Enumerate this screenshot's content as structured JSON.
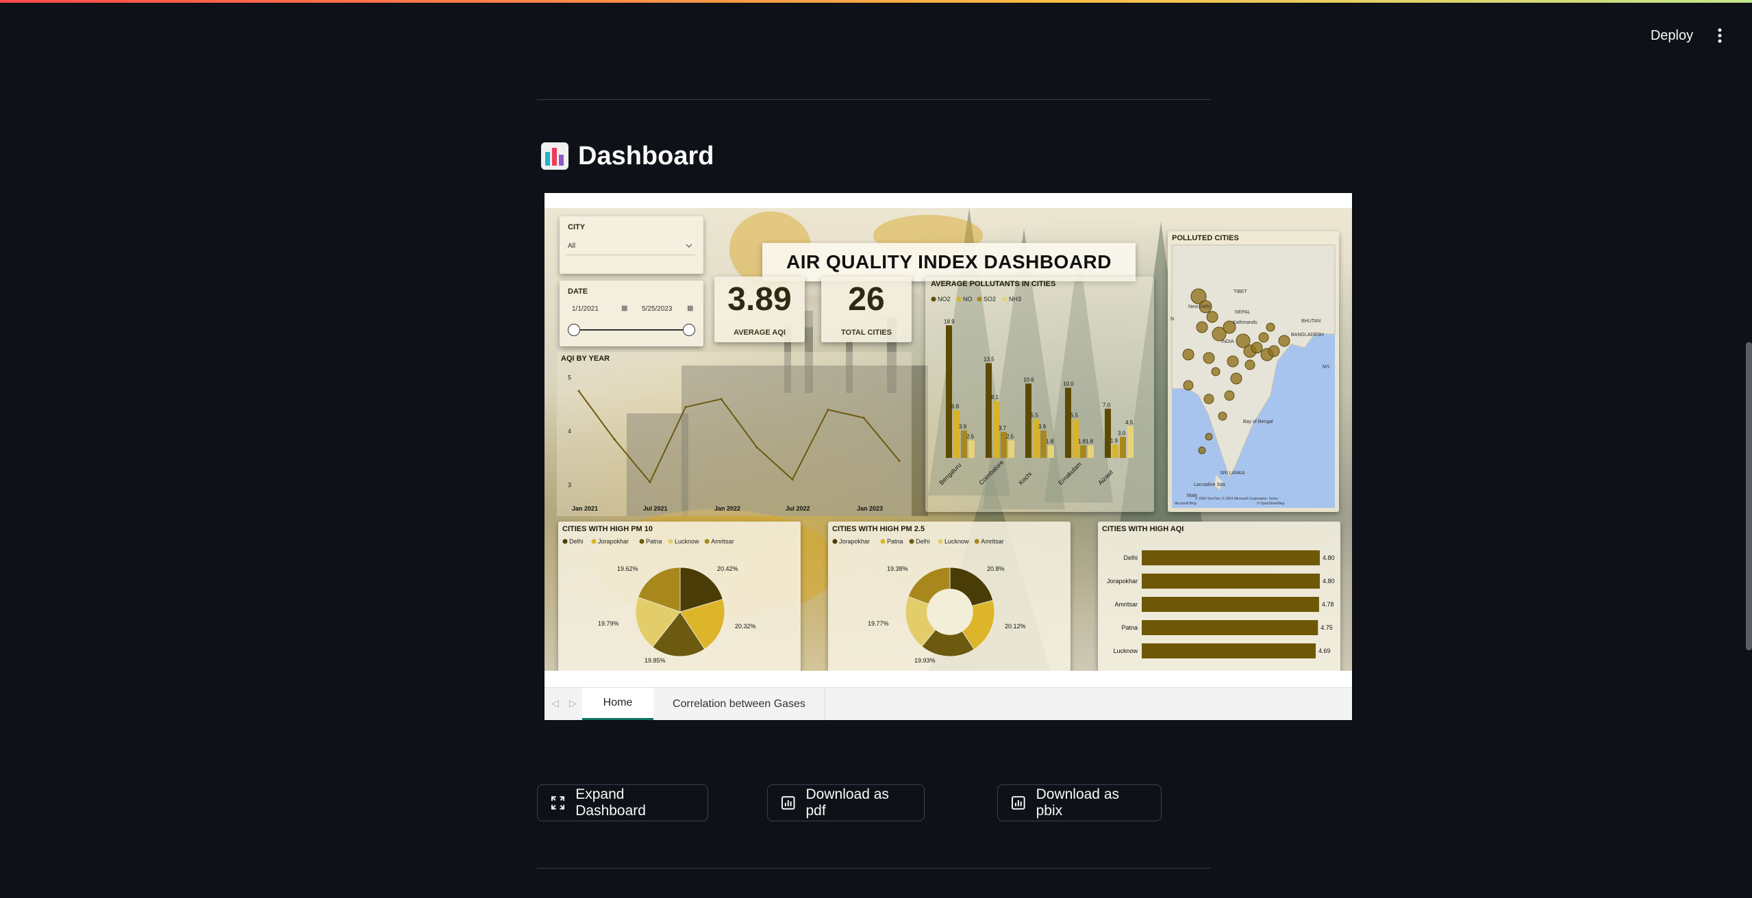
{
  "header": {
    "deploy_label": "Deploy"
  },
  "page": {
    "title": "Dashboard"
  },
  "report": {
    "title": "AIR QUALITY INDEX DASHBOARD",
    "city_filter": {
      "label": "CITY",
      "value": "All"
    },
    "date_filter": {
      "label": "DATE",
      "start": "1/1/2021",
      "end": "5/25/2023"
    },
    "kpis": [
      {
        "value": "3.89",
        "label": "AVERAGE AQI"
      },
      {
        "value": "26",
        "label": "TOTAL CITIES"
      }
    ],
    "map": {
      "title": "POLLUTED CITIES",
      "place_labels": [
        "New Delhi",
        "NEPAL",
        "Kathmandu",
        "TIBET",
        "BHUTAN",
        "BANGLADESH",
        "INDIA",
        "MY.",
        "Bay of Bengal",
        "SRI LANKA",
        "Laccadive Sea",
        "Male",
        "N"
      ],
      "attribution": "© 2024 TomTom, © 2024 Microsoft Corporation, Terms",
      "attribution2": "© OpenStreetMap",
      "brand": "Microsoft Bing"
    },
    "pm10_legend_title": "CITIES WITH HIGH PM 10",
    "pm25_legend_title": "CITIES WITH HIGH PM 2.5",
    "aqi_bar_title": "CITIES WITH HIGH AQI"
  },
  "chart_data": [
    {
      "type": "line",
      "title": "AQI BY YEAR",
      "x": [
        "Jan 2021",
        "Apr 2021",
        "Jul 2021",
        "Oct 2021",
        "Jan 2022",
        "Apr 2022",
        "Jul 2022",
        "Oct 2022",
        "Jan 2023",
        "Apr 2023"
      ],
      "x_tick_labels": [
        "Jan 2021",
        "Jul 2021",
        "Jan 2022",
        "Jul 2022",
        "Jan 2023"
      ],
      "values": [
        4.75,
        3.85,
        3.05,
        4.45,
        4.6,
        3.7,
        3.1,
        4.4,
        4.25,
        3.45
      ],
      "ylim": [
        2.8,
        5.2
      ],
      "yticks": [
        3,
        4,
        5
      ],
      "colors": {
        "line": "#6b5a10"
      }
    },
    {
      "type": "bar",
      "title": "AVERAGE POLLUTANTS IN CITIES",
      "categories": [
        "Bengaluru",
        "Coimbatore",
        "Kochi",
        "Ernakulam",
        "Aizawl"
      ],
      "series": [
        {
          "name": "NO2",
          "values": [
            18.9,
            13.5,
            10.6,
            10.0,
            7.0
          ],
          "labels": [
            "18.9",
            "13.5",
            "10.6",
            "10.0",
            "7.0"
          ]
        },
        {
          "name": "NO",
          "values": [
            6.8,
            8.1,
            5.5,
            5.5,
            1.9
          ],
          "labels": [
            "6.8",
            "8.1",
            "5.5",
            "5.5",
            "1.9"
          ]
        },
        {
          "name": "SO2",
          "values": [
            3.9,
            3.7,
            3.9,
            1.8,
            3.0
          ],
          "labels": [
            "3.9",
            "3.7",
            "3.9",
            "1.8",
            "3.0"
          ]
        },
        {
          "name": "NH3",
          "values": [
            2.5,
            2.5,
            1.8,
            1.8,
            4.5
          ],
          "labels": [
            "2.5",
            "2.5",
            "1.8",
            "1.8",
            "4.5"
          ]
        }
      ],
      "ylim": [
        0,
        20
      ],
      "colors": [
        "#5c4a00",
        "#d9b42a",
        "#a8881c",
        "#e8d27a"
      ]
    },
    {
      "type": "pie",
      "title": "CITIES WITH HIGH PM 10",
      "categories": [
        "Delhi",
        "Jorapokhar",
        "Patna",
        "Lucknow",
        "Amritsar"
      ],
      "values": [
        20.42,
        20.32,
        19.85,
        19.79,
        19.62
      ],
      "labels": [
        "20.42%",
        "20.32%",
        "19.85%",
        "19.79%",
        "19.62%"
      ],
      "colors": [
        "#4a3c06",
        "#dcb52a",
        "#6b5a10",
        "#e3cd6b",
        "#a8881c"
      ]
    },
    {
      "type": "pie",
      "title": "CITIES WITH HIGH PM 2.5",
      "categories": [
        "Jorapokhar",
        "Patna",
        "Delhi",
        "Lucknow",
        "Amritsar"
      ],
      "values": [
        20.8,
        20.12,
        19.93,
        19.77,
        19.38
      ],
      "labels": [
        "20.8%",
        "20.12%",
        "19.93%",
        "19.77%",
        "19.38%"
      ],
      "colors": [
        "#4a3c06",
        "#dcb52a",
        "#6b5a10",
        "#e3cd6b",
        "#a8881c"
      ],
      "donut": true
    },
    {
      "type": "bar",
      "orientation": "horizontal",
      "title": "CITIES WITH HIGH AQI",
      "categories": [
        "Delhi",
        "Jorapokhar",
        "Amritsar",
        "Patna",
        "Lucknow"
      ],
      "values": [
        4.8,
        4.8,
        4.78,
        4.75,
        4.69
      ],
      "labels": [
        "4.80",
        "4.80",
        "4.78",
        "4.75",
        "4.69"
      ],
      "xlim": [
        0,
        4.8
      ],
      "colors": {
        "bar": "#6e5808"
      }
    }
  ],
  "tabs": [
    {
      "label": "Home",
      "active": true
    },
    {
      "label": "Correlation between Gases",
      "active": false
    }
  ],
  "actions": [
    {
      "label": "Expand Dashboard",
      "icon": "expand-icon"
    },
    {
      "label": "Download as pdf",
      "icon": "bar-chart-icon"
    },
    {
      "label": "Download as pbix",
      "icon": "bar-chart-icon"
    }
  ]
}
